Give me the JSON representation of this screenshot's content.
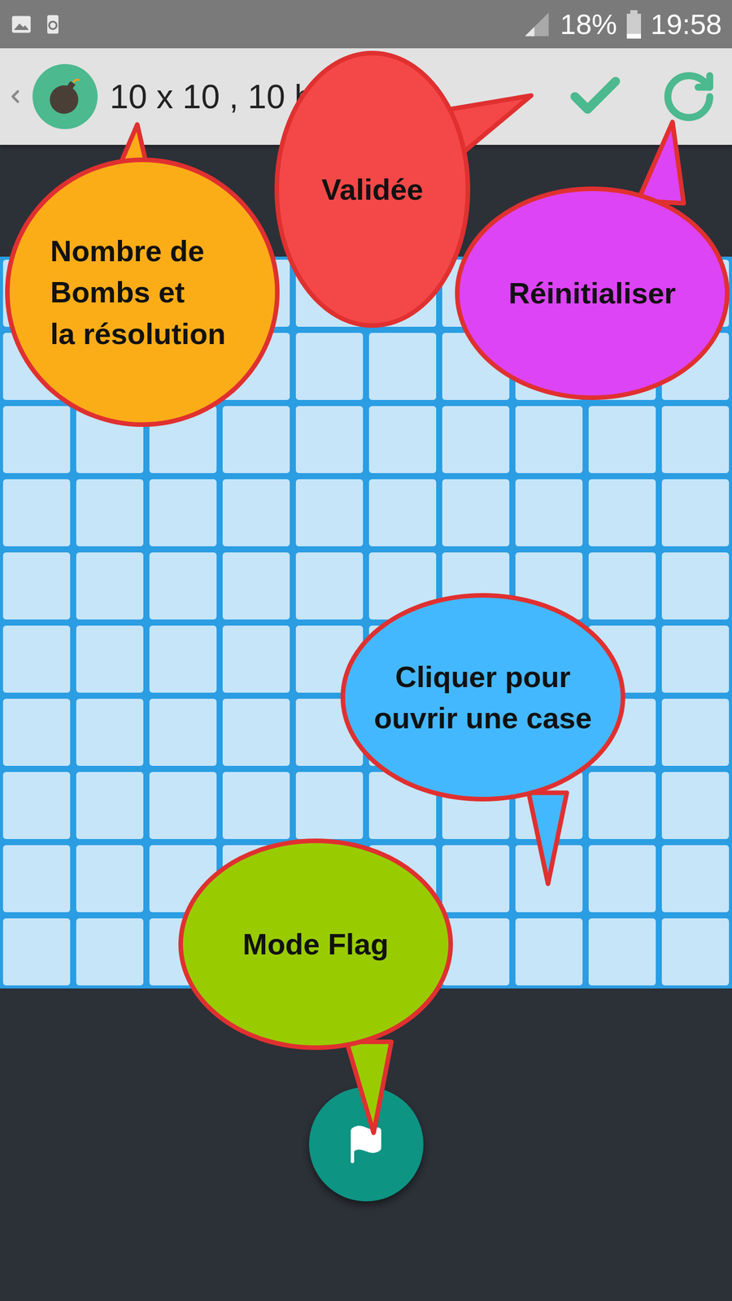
{
  "status_bar": {
    "battery": "18%",
    "time": "19:58"
  },
  "toolbar": {
    "title": "10 x 10 , 10 b"
  },
  "board": {
    "rows": [
      {
        "cells": [
          {
            "opened": false
          },
          {
            "opened": false
          },
          {
            "opened": false
          },
          {
            "opened": false
          },
          {
            "opened": false
          },
          {
            "opened": false
          },
          {
            "opened": false
          },
          {
            "opened": false
          },
          {
            "opened": false
          },
          {
            "opened": false
          }
        ]
      },
      {
        "cells": [
          {
            "opened": false
          },
          {
            "opened": false
          },
          {
            "opened": false
          },
          {
            "opened": false
          },
          {
            "opened": false
          },
          {
            "opened": false
          },
          {
            "opened": false
          },
          {
            "opened": false
          },
          {
            "opened": false
          },
          {
            "opened": false
          }
        ]
      },
      {
        "cells": [
          {
            "opened": false
          },
          {
            "opened": false
          },
          {
            "opened": false
          },
          {
            "opened": false
          },
          {
            "opened": false
          },
          {
            "opened": false
          },
          {
            "opened": false
          },
          {
            "opened": false
          },
          {
            "opened": false
          },
          {
            "opened": false
          }
        ]
      },
      {
        "cells": [
          {
            "opened": false
          },
          {
            "opened": false
          },
          {
            "opened": false
          },
          {
            "opened": false
          },
          {
            "opened": false
          },
          {
            "opened": false
          },
          {
            "opened": false
          },
          {
            "opened": false
          },
          {
            "opened": false
          },
          {
            "opened": false
          }
        ]
      },
      {
        "cells": [
          {
            "opened": false
          },
          {
            "opened": false
          },
          {
            "opened": false
          },
          {
            "opened": false
          },
          {
            "opened": false
          },
          {
            "opened": false
          },
          {
            "opened": false
          },
          {
            "opened": false
          },
          {
            "opened": false
          },
          {
            "opened": false
          }
        ]
      },
      {
        "cells": [
          {
            "opened": false
          },
          {
            "opened": false
          },
          {
            "opened": false
          },
          {
            "opened": false
          },
          {
            "opened": false
          },
          {
            "opened": false
          },
          {
            "opened": false
          },
          {
            "opened": false
          },
          {
            "opened": false
          },
          {
            "opened": false
          }
        ]
      },
      {
        "cells": [
          {
            "opened": false
          },
          {
            "opened": false
          },
          {
            "opened": false
          },
          {
            "opened": false
          },
          {
            "opened": false
          },
          {
            "opened": false
          },
          {
            "opened": false
          },
          {
            "opened": false
          },
          {
            "opened": false
          },
          {
            "opened": false
          }
        ]
      },
      {
        "cells": [
          {
            "opened": false
          },
          {
            "opened": false
          },
          {
            "opened": false
          },
          {
            "opened": false
          },
          {
            "opened": false
          },
          {
            "opened": false
          },
          {
            "opened": false
          },
          {
            "opened": false
          },
          {
            "opened": false
          },
          {
            "opened": false
          }
        ]
      },
      {
        "cells": [
          {
            "opened": false
          },
          {
            "opened": false
          },
          {
            "opened": false
          },
          {
            "opened": false
          },
          {
            "opened": false
          },
          {
            "opened": false
          },
          {
            "opened": false
          },
          {
            "opened": false
          },
          {
            "opened": false
          },
          {
            "opened": false
          }
        ]
      },
      {
        "cells": [
          {
            "opened": false
          },
          {
            "opened": false
          },
          {
            "opened": false
          },
          {
            "opened": false
          },
          {
            "opened": false
          },
          {
            "opened": false
          },
          {
            "opened": false
          },
          {
            "opened": false
          },
          {
            "opened": false
          },
          {
            "opened": false
          }
        ]
      }
    ]
  },
  "flag_button": {
    "active": false
  },
  "annotations": [
    {
      "lines": [
        "Nombre de",
        "Bombs et",
        "la résolution"
      ],
      "color": "#fbad18"
    },
    {
      "lines": [
        "Validée"
      ],
      "color": "#f44848"
    },
    {
      "lines": [
        "Réinitialiser"
      ],
      "color": "#dd44f6"
    },
    {
      "lines": [
        "Cliquer pour",
        "ouvrir une case"
      ],
      "color": "#44b8ff"
    },
    {
      "lines": [
        "Mode Flag"
      ],
      "color": "#99cc00"
    }
  ]
}
